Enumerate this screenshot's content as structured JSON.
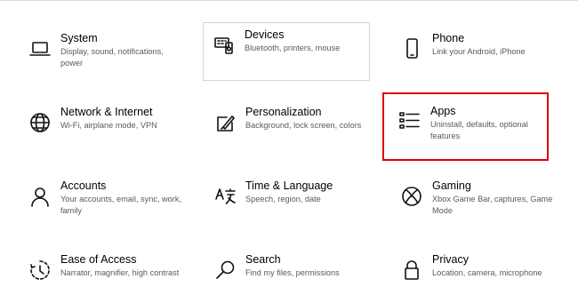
{
  "settings": {
    "tiles": [
      {
        "title": "System",
        "description": "Display, sound, notifications, power",
        "icon": "laptop-icon"
      },
      {
        "title": "Devices",
        "description": "Bluetooth, printers, mouse",
        "icon": "devices-icon"
      },
      {
        "title": "Phone",
        "description": "Link your Android, iPhone",
        "icon": "phone-icon"
      },
      {
        "title": "Network & Internet",
        "description": "Wi-Fi, airplane mode, VPN",
        "icon": "globe-icon"
      },
      {
        "title": "Personalization",
        "description": "Background, lock screen, colors",
        "icon": "paintbrush-icon"
      },
      {
        "title": "Apps",
        "description": "Uninstall, defaults, optional features",
        "icon": "apps-list-icon"
      },
      {
        "title": "Accounts",
        "description": "Your accounts, email, sync, work, family",
        "icon": "person-icon"
      },
      {
        "title": "Time & Language",
        "description": "Speech, region, date",
        "icon": "time-language-icon"
      },
      {
        "title": "Gaming",
        "description": "Xbox Game Bar, captures, Game Mode",
        "icon": "xbox-icon"
      },
      {
        "title": "Ease of Access",
        "description": "Narrator, magnifier, high contrast",
        "icon": "ease-of-access-icon"
      },
      {
        "title": "Search",
        "description": "Find my files, permissions",
        "icon": "search-icon"
      },
      {
        "title": "Privacy",
        "description": "Location, camera, microphone",
        "icon": "lock-icon"
      }
    ]
  },
  "colors": {
    "highlight": "#e00000",
    "description_text": "#5a5a5a"
  }
}
